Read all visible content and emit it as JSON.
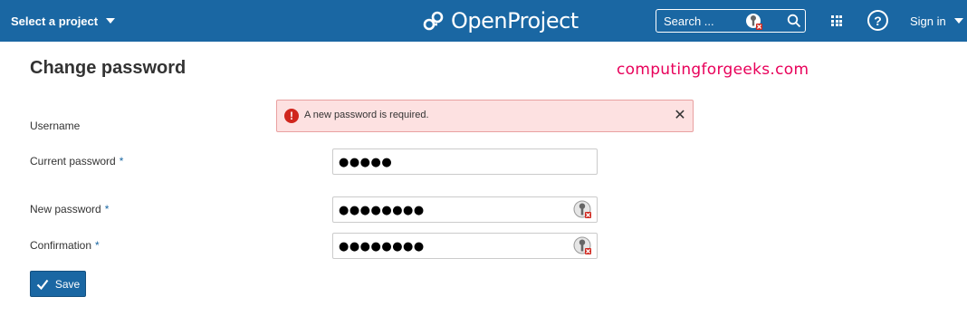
{
  "header": {
    "project_select_label": "Select a project",
    "logo_text": "OpenProject",
    "search_placeholder": "Search ...",
    "signin_label": "Sign in",
    "help_glyph": "?",
    "brand_color": "#1a67a3"
  },
  "page": {
    "title": "Change password",
    "watermark": "computingforgeeks.com"
  },
  "flash": {
    "message": "A new password is required.",
    "icon": "error-icon",
    "close_glyph": "✕"
  },
  "form": {
    "username_label": "Username",
    "current_password_label": "Current password",
    "new_password_label": "New password",
    "confirmation_label": "Confirmation",
    "required_marker": "*",
    "current_password_value": "●●●●●",
    "new_password_value": "●●●●●●●●",
    "confirmation_value": "●●●●●●●●",
    "save_label": "Save"
  },
  "icons": {
    "grid": "grid-icon",
    "help": "help-icon",
    "search": "search-icon",
    "password_manager": "password-manager-icon",
    "save": "checkmark-icon"
  }
}
